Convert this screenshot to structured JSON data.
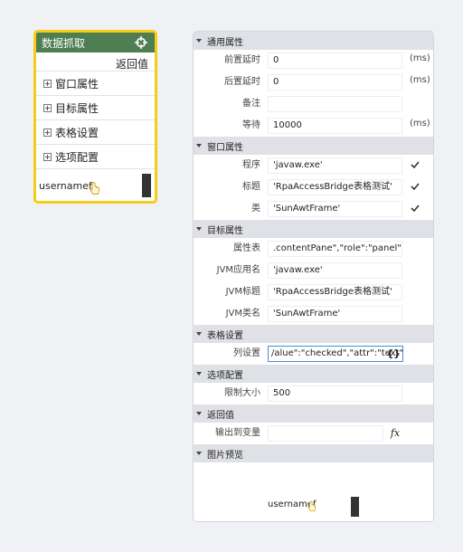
{
  "node": {
    "title": "数据抓取",
    "return_label": "返回值",
    "sections": [
      "窗口属性",
      "目标属性",
      "表格设置",
      "选项配置"
    ],
    "preview_text": "usernamef"
  },
  "panel": {
    "general": {
      "title": "通用属性",
      "pre_delay": {
        "label": "前置延时",
        "value": "0",
        "unit": "(ms)"
      },
      "post_delay": {
        "label": "后置延时",
        "value": "0",
        "unit": "(ms)"
      },
      "note": {
        "label": "备注",
        "value": ""
      },
      "wait": {
        "label": "等待",
        "value": "10000",
        "unit": "(ms)"
      }
    },
    "window": {
      "title": "窗口属性",
      "program": {
        "label": "程序",
        "value": "'javaw.exe'"
      },
      "caption": {
        "label": "标题",
        "value": "'RpaAccessBridge表格测试'"
      },
      "class": {
        "label": "类",
        "value": "'SunAwtFrame'"
      }
    },
    "target": {
      "title": "目标属性",
      "attr_table": {
        "label": "属性表",
        "value": ".contentPane\",\"role\":\"panel\"}]"
      },
      "jvm_app": {
        "label": "JVM应用名",
        "value": "'javaw.exe'"
      },
      "jvm_title": {
        "label": "JVM标题",
        "value": "'RpaAccessBridge表格测试'"
      },
      "jvm_class": {
        "label": "JVM类名",
        "value": "'SunAwtFrame'"
      }
    },
    "table": {
      "title": "表格设置",
      "columns": {
        "label": "列设置",
        "value": "/alue\":\"checked\",\"attr\":\"text\"}]",
        "brace": "{}"
      }
    },
    "options": {
      "title": "选项配置",
      "limit": {
        "label": "限制大小",
        "value": "500"
      }
    },
    "return": {
      "title": "返回值",
      "output": {
        "label": "输出到变量",
        "value": "",
        "fx": "fx"
      }
    },
    "preview": {
      "title": "图片预览",
      "text": "usernamef"
    }
  }
}
